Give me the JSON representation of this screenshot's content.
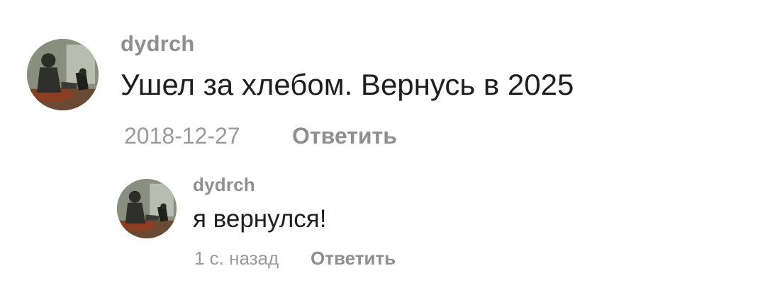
{
  "comments": [
    {
      "username": "dydrch",
      "text": "Ушел за хлебом. Вернусь в 2025",
      "timestamp": "2018-12-27",
      "reply_label": "Ответить",
      "avatar_icon": "user-avatar-photo"
    }
  ],
  "replies": [
    {
      "username": "dydrch",
      "text": "я вернулся!",
      "timestamp": "1 с. назад",
      "reply_label": "Ответить",
      "avatar_icon": "user-avatar-photo"
    }
  ]
}
